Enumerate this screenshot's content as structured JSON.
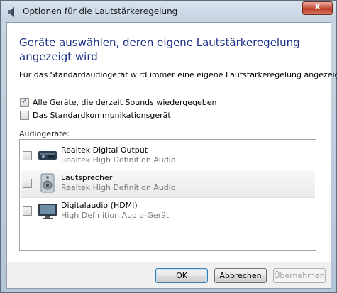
{
  "window": {
    "title": "Optionen für die Lautstärkeregelung",
    "close_glyph": "x"
  },
  "heading": "Geräte auswählen, deren eigene Lautstärkeregelung angezeigt wird",
  "description": "Für das Standardaudiogerät wird immer eine eigene Lautstärkeregelung angezeigt.",
  "options": [
    {
      "label": "Alle Geräte, die derzeit Sounds wiedergegeben",
      "checked": true
    },
    {
      "label": "Das Standardkommunikationsgerät",
      "checked": false
    }
  ],
  "devices_label": "Audiogeräte:",
  "devices": [
    {
      "name": "Realtek Digital Output",
      "subtitle": "Realtek High Definition Audio",
      "checked": false,
      "icon": "digital-output-icon"
    },
    {
      "name": "Lautsprecher",
      "subtitle": "Realtek High Definition Audio",
      "checked": false,
      "icon": "speaker-icon",
      "selected": true
    },
    {
      "name": "Digitalaudio (HDMI)",
      "subtitle": "High Definition Audio-Gerät",
      "checked": false,
      "icon": "monitor-icon"
    }
  ],
  "buttons": {
    "ok": "OK",
    "cancel": "Abbrechen",
    "apply": "Übernehmen"
  }
}
